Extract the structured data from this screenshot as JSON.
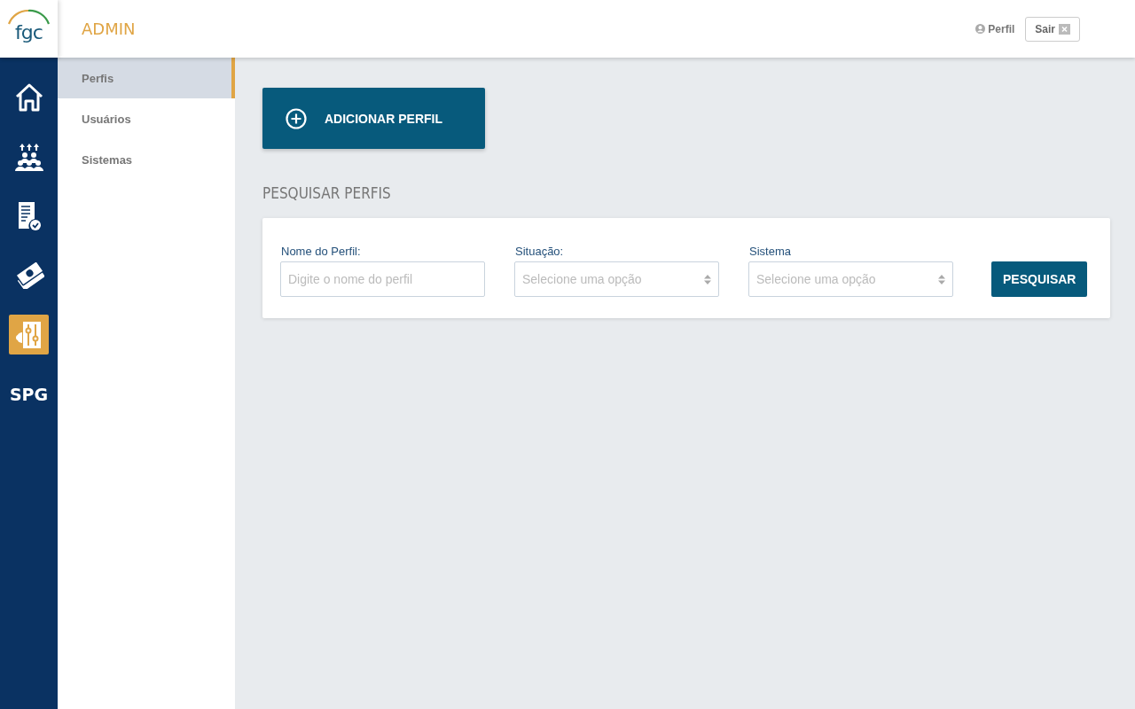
{
  "header": {
    "logo": "fgc",
    "title": "ADMIN",
    "profile_link": "Perfil",
    "logout_button": "Sair"
  },
  "rail": [
    {
      "kind": "home",
      "selected": false
    },
    {
      "kind": "people",
      "selected": false
    },
    {
      "kind": "invoice",
      "selected": false
    },
    {
      "kind": "money",
      "selected": false
    },
    {
      "kind": "settings",
      "selected": true
    },
    {
      "kind": "text",
      "label": "SPG",
      "selected": false
    }
  ],
  "submenu": [
    {
      "label": "Perfis",
      "selected": true
    },
    {
      "label": "Usuários",
      "selected": false
    },
    {
      "label": "Sistemas",
      "selected": false
    }
  ],
  "add_button": "ADICIONAR PERFIL",
  "search_title": "PESQUISAR PERFIS",
  "filters": [
    {
      "kind": "text",
      "label": "Nome do Perfil:",
      "placeholder": "Digite o nome do perfil"
    },
    {
      "kind": "select",
      "label": "Situação:",
      "placeholder": "Selecione uma opção"
    },
    {
      "kind": "select",
      "label": "Sistema",
      "placeholder": "Selecione uma opção"
    }
  ],
  "search_button": "PESQUISAR"
}
